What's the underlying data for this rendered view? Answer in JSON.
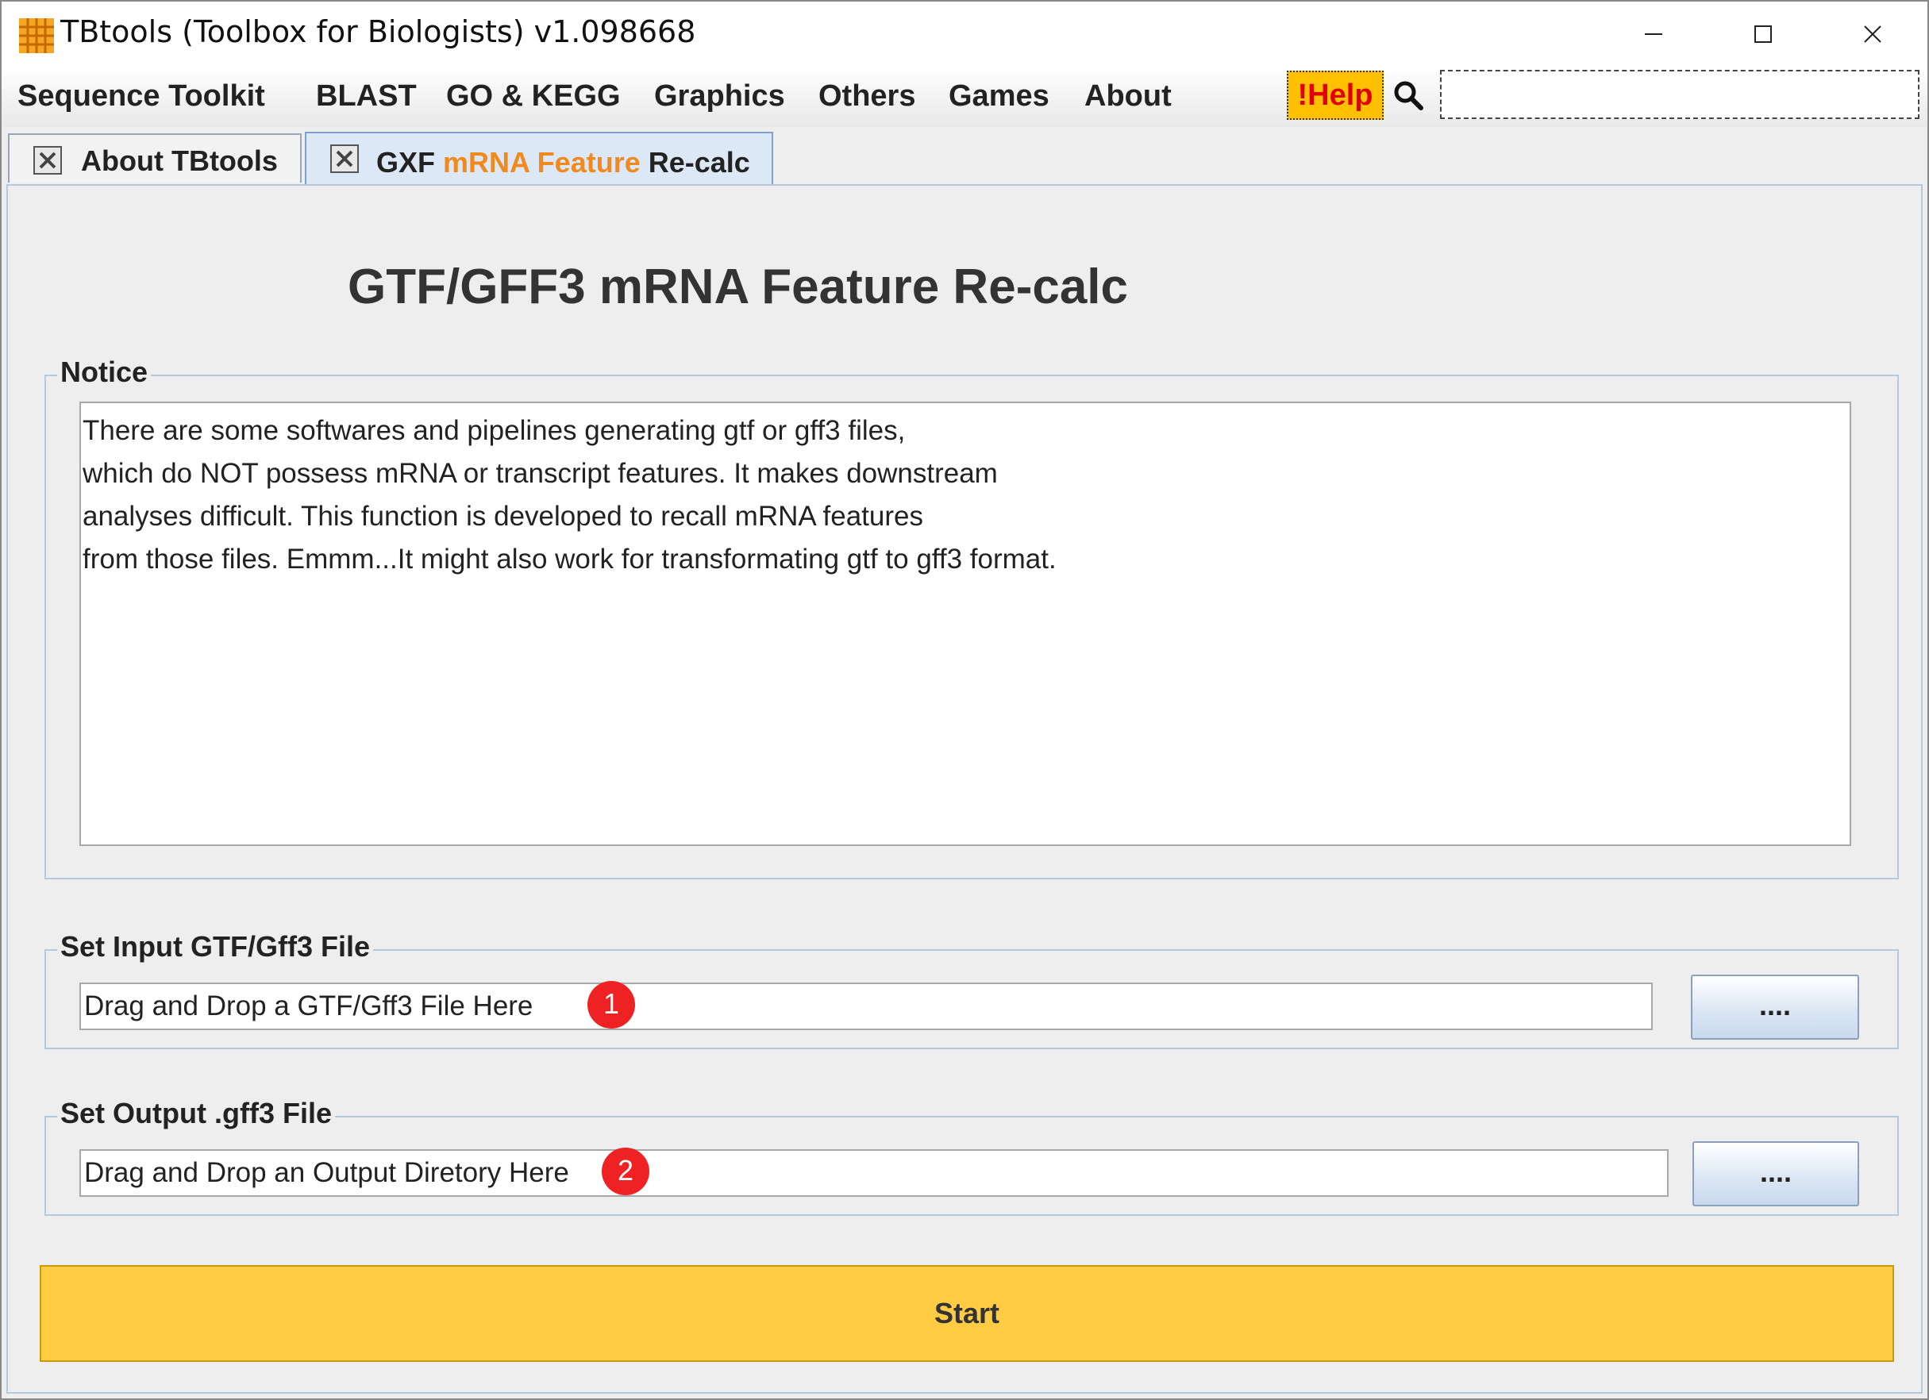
{
  "window": {
    "title": "TBtools (Toolbox for Biologists) v1.098668"
  },
  "menu": {
    "items": [
      "Sequence Toolkit",
      "BLAST",
      "GO & KEGG",
      "Graphics",
      "Others",
      "Games",
      "About"
    ],
    "help_label": "!Help",
    "search_value": ""
  },
  "tabs": [
    {
      "label": "About TBtools"
    },
    {
      "label_parts": [
        "GXF ",
        "mRNA Feature",
        " Re-calc"
      ]
    }
  ],
  "main": {
    "title": "GTF/GFF3 mRNA Feature Re-calc",
    "notice": {
      "legend": "Notice",
      "lines": [
        "There are some softwares and pipelines generating gtf or gff3 files,",
        "which do NOT possess mRNA or transcript features. It makes downstream",
        "analyses difficult. This function is developed to recall mRNA features",
        "from those files. Emmm...It might also work for transformating gtf to gff3 format."
      ]
    },
    "input_file": {
      "legend": "Set Input GTF/Gff3 File",
      "value": "Drag and Drop a GTF/Gff3 File Here",
      "browse_label": "....",
      "badge": "1"
    },
    "output_file": {
      "legend": "Set Output .gff3 File",
      "value": "Drag and Drop an Output Diretory Here",
      "browse_label": "....",
      "badge": "2"
    },
    "start_label": "Start"
  },
  "colors": {
    "accent_orange": "#f08a1c",
    "help_bg": "#ffc000",
    "help_text": "#e00000",
    "start_bg": "#ffcc44",
    "badge_red": "#ee2222",
    "panel_border": "#b8c8dc"
  }
}
